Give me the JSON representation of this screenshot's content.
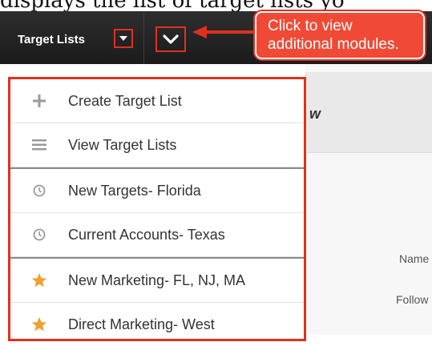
{
  "caption": "displays the list of target lists yo",
  "navbar": {
    "module_label": "Target Lists",
    "callout_text_line1": "Click to view",
    "callout_text_line2": "additional modules."
  },
  "menu": {
    "actions": [
      {
        "label": "Create Target List",
        "icon": "plus-icon"
      },
      {
        "label": "View Target Lists",
        "icon": "list-icon"
      }
    ],
    "recent": [
      {
        "label": "New Targets- Florida",
        "icon": "clock-icon"
      },
      {
        "label": "Current Accounts- Texas",
        "icon": "clock-icon"
      }
    ],
    "favorites": [
      {
        "label": "New Marketing- FL, NJ, MA",
        "icon": "star-icon"
      },
      {
        "label": "Direct Marketing- West",
        "icon": "star-icon"
      }
    ]
  },
  "background": {
    "header_fragment": "w",
    "name_label": "Name",
    "follow_label": "Follow"
  },
  "colors": {
    "highlight": "#e03020",
    "callout_bg": "#f04a36",
    "navbar": "#222222",
    "star": "#f0a030",
    "icon_gray": "#9a9a9a"
  }
}
